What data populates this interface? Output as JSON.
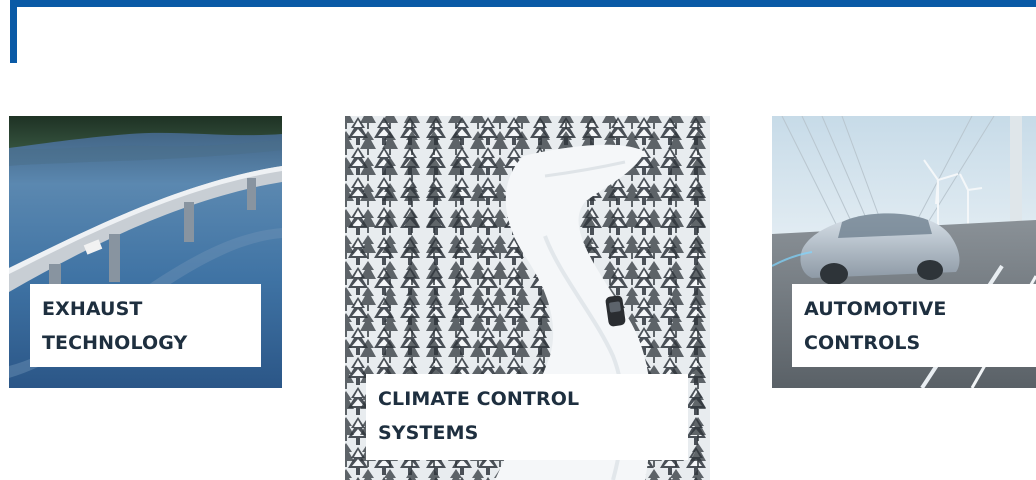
{
  "accent_color": "#0a5aa6",
  "cards": [
    {
      "title_line1": "EXHAUST",
      "title_line2": "TECHNOLOGY",
      "image": "bridge-over-lake-photo"
    },
    {
      "title_line1": "CLIMATE CONTROL",
      "title_line2": "SYSTEMS",
      "image": "snowy-forest-road-photo"
    },
    {
      "title_line1": "AUTOMOTIVE",
      "title_line2": "CONTROLS",
      "image": "electric-car-wind-turbines-photo"
    }
  ]
}
